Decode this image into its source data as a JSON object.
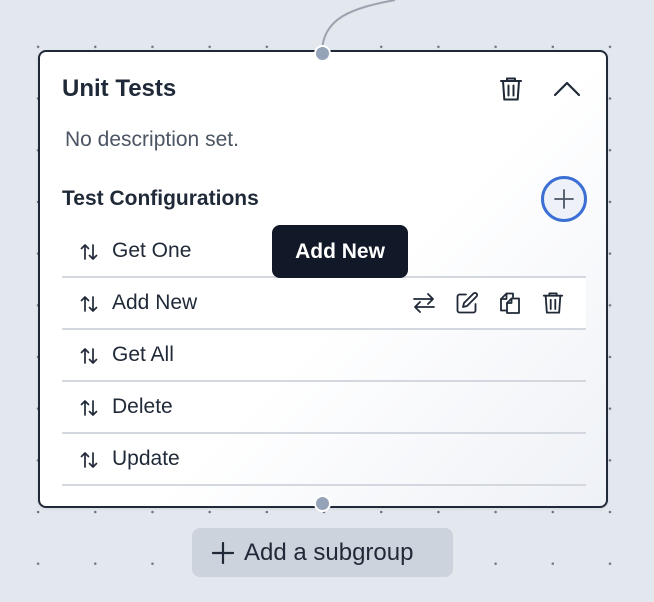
{
  "group": {
    "title": "Unit Tests",
    "description": "No description set."
  },
  "section": {
    "title": "Test Configurations"
  },
  "tooltip": {
    "text": "Add New"
  },
  "configurations": [
    {
      "label": "Get One",
      "icon": "sort-arrows-icon"
    },
    {
      "label": "Add New",
      "icon": "sort-arrows-icon",
      "hovered": true
    },
    {
      "label": "Get All",
      "icon": "sort-arrows-icon"
    },
    {
      "label": "Delete",
      "icon": "sort-arrows-icon"
    },
    {
      "label": "Update",
      "icon": "sort-arrows-icon"
    }
  ],
  "row_actions": [
    "swap-icon",
    "edit-icon",
    "copy-icon",
    "trash-icon"
  ],
  "footer": {
    "add_subgroup_label": "Add a subgroup"
  },
  "colors": {
    "canvas": "#e3e7ee",
    "card_border": "#1f2937",
    "accent": "#3b6fd4",
    "tooltip_bg": "#111827",
    "button_bg": "#cdd3dd"
  }
}
